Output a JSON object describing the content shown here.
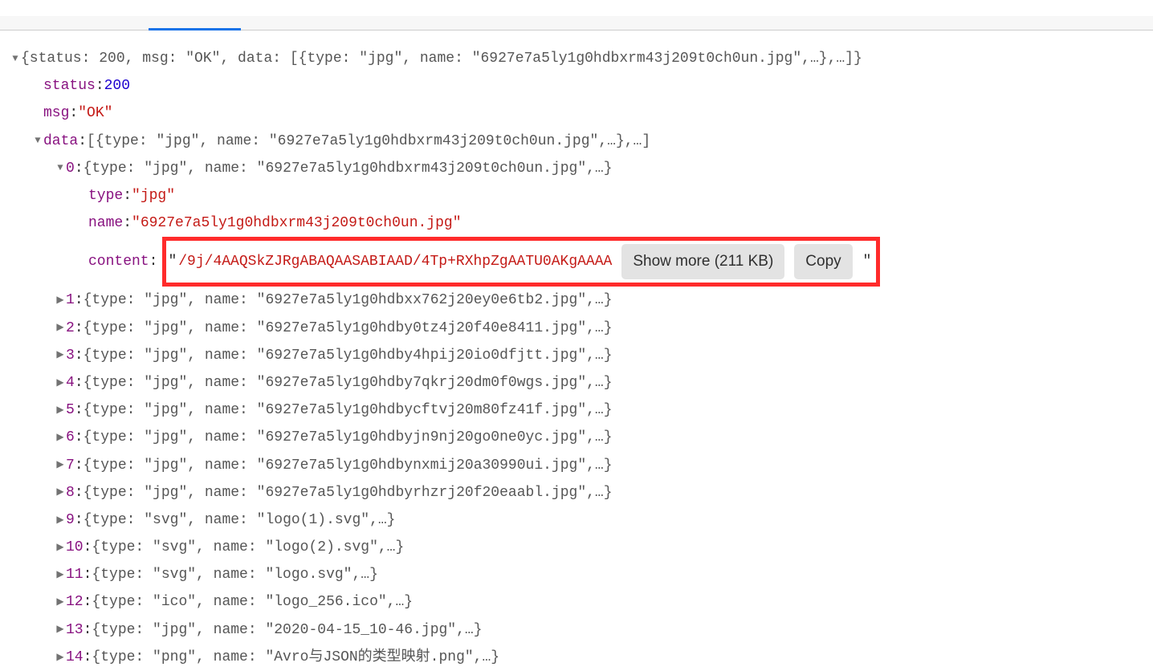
{
  "root_summary": "{status: 200, msg: \"OK\", data: [{type: \"jpg\", name: \"6927e7a5ly1g0hdbxrm43j209t0ch0un.jpg\",…},…]}",
  "status_key": "status",
  "status_value": "200",
  "msg_key": "msg",
  "msg_value": "\"OK\"",
  "data_key": "data",
  "data_summary": "[{type: \"jpg\", name: \"6927e7a5ly1g0hdbxrm43j209t0ch0un.jpg\",…},…]",
  "item0_key": "0",
  "item0_summary": "{type: \"jpg\", name: \"6927e7a5ly1g0hdbxrm43j209t0ch0un.jpg\",…}",
  "item0_type_key": "type",
  "item0_type_value": "\"jpg\"",
  "item0_name_key": "name",
  "item0_name_value": "\"6927e7a5ly1g0hdbxrm43j209t0ch0un.jpg\"",
  "item0_content_key": "content",
  "item0_content_value": "/9j/4AAQSkZJRgABAQAASABIAAD/4Tp+RXhpZgAATU0AKgAAAA",
  "show_more_label": "Show more (211 KB)",
  "copy_label": "Copy",
  "items": [
    {
      "idx": "1",
      "type": "jpg",
      "name": "6927e7a5ly1g0hdbxx762j20ey0e6tb2.jpg"
    },
    {
      "idx": "2",
      "type": "jpg",
      "name": "6927e7a5ly1g0hdby0tz4j20f40e8411.jpg"
    },
    {
      "idx": "3",
      "type": "jpg",
      "name": "6927e7a5ly1g0hdby4hpij20io0dfjtt.jpg"
    },
    {
      "idx": "4",
      "type": "jpg",
      "name": "6927e7a5ly1g0hdby7qkrj20dm0f0wgs.jpg"
    },
    {
      "idx": "5",
      "type": "jpg",
      "name": "6927e7a5ly1g0hdbycftvj20m80fz41f.jpg"
    },
    {
      "idx": "6",
      "type": "jpg",
      "name": "6927e7a5ly1g0hdbyjn9nj20go0ne0yc.jpg"
    },
    {
      "idx": "7",
      "type": "jpg",
      "name": "6927e7a5ly1g0hdbynxmij20a30990ui.jpg"
    },
    {
      "idx": "8",
      "type": "jpg",
      "name": "6927e7a5ly1g0hdbyrhzrj20f20eaabl.jpg"
    },
    {
      "idx": "9",
      "type": "svg",
      "name": "logo(1).svg"
    },
    {
      "idx": "10",
      "type": "svg",
      "name": "logo(2).svg"
    },
    {
      "idx": "11",
      "type": "svg",
      "name": "logo.svg"
    },
    {
      "idx": "12",
      "type": "ico",
      "name": "logo_256.ico"
    },
    {
      "idx": "13",
      "type": "jpg",
      "name": "2020-04-15_10-46.jpg"
    },
    {
      "idx": "14",
      "type": "png",
      "name": "Avro与JSON的类型映射.png"
    }
  ]
}
